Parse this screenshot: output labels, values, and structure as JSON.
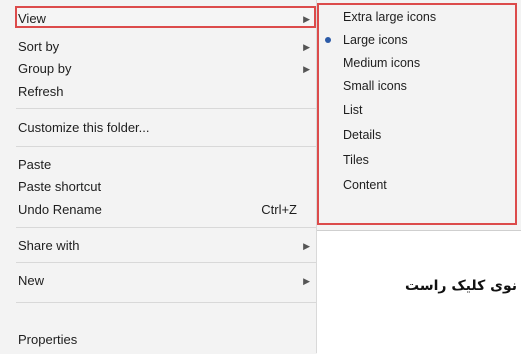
{
  "context_menu": {
    "view": "View",
    "sort_by": "Sort by",
    "group_by": "Group by",
    "refresh": "Refresh",
    "customize": "Customize this folder...",
    "paste": "Paste",
    "paste_shortcut": "Paste shortcut",
    "undo_rename": "Undo Rename",
    "undo_shortcut": "Ctrl+Z",
    "share_with": "Share with",
    "new": "New",
    "properties": "Properties"
  },
  "submenu": {
    "items": [
      "Extra large icons",
      "Large icons",
      "Medium icons",
      "Small icons",
      "List",
      "Details",
      "Tiles",
      "Content"
    ],
    "selected": "Large icons"
  },
  "caption": "نوی کلیک راست",
  "colors": {
    "highlight_border": "#dc4b4b",
    "bullet": "#2b5aa7"
  },
  "icons": {
    "submenu_arrow": "triangle-right-icon",
    "selected_marker": "radio-bullet-icon"
  }
}
